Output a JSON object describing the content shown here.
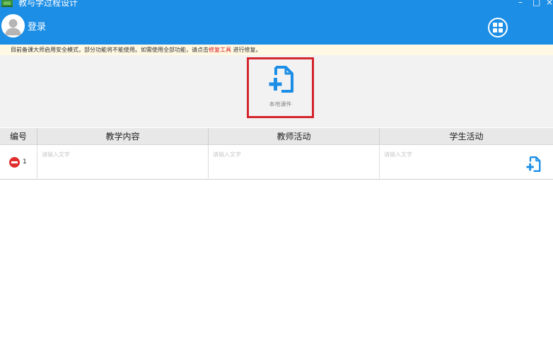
{
  "window": {
    "title": "教与学过程设计",
    "minimize": "–",
    "maximize": "□",
    "close": "×"
  },
  "header": {
    "login_label": "登录",
    "accent_color": "#1c8ee6"
  },
  "notice": {
    "text_before": "目前备课大师启用安全模式，部分功能将不能使用。如需使用全部功能，请点击",
    "link_text": "修复工具",
    "text_after": " 进行修复。",
    "link_color": "#d7191f"
  },
  "toolbar": {
    "local_courseware_label": "本地课件",
    "icon": "file-add-icon"
  },
  "table": {
    "columns": [
      "编号",
      "教学内容",
      "教师活动",
      "学生活动"
    ],
    "rows": [
      {
        "index": "1",
        "content_placeholder": "请输入文字",
        "teacher_placeholder": "请输入文字",
        "student_placeholder": "请输入文字"
      }
    ]
  },
  "icons": {
    "avatar": "user-avatar-icon",
    "apps": "apps-grid-icon",
    "remove": "remove-row-icon",
    "add_row": "file-add-icon"
  }
}
